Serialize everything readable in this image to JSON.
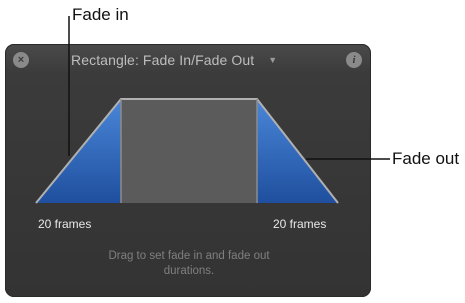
{
  "callouts": {
    "fade_in": "Fade in",
    "fade_out": "Fade out"
  },
  "hud": {
    "title": "Rectangle: Fade In/Fade Out",
    "title_dropdown_icon": "triangle-down",
    "close_icon": "close-x",
    "close_glyph": "×",
    "info_icon": "info-i",
    "info_glyph": "i",
    "fade_in_duration": "20 frames",
    "fade_out_duration": "20 frames",
    "hint": "Drag to set fade in and fade out durations."
  },
  "colors": {
    "hud_background": "#333333",
    "fade_ramp": "#2f63b4",
    "hold_region": "#5b5b5b",
    "outline": "#a8a8a8"
  }
}
